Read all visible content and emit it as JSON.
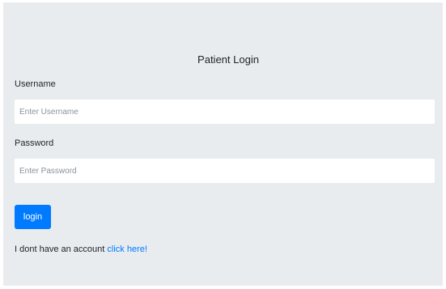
{
  "form": {
    "title": "Patient Login",
    "username_label": "Username",
    "username_placeholder": "Enter Username",
    "password_label": "Password",
    "password_placeholder": "Enter Password",
    "login_button": "login",
    "signup_prompt": "I dont have an account",
    "signup_link": "click here!"
  },
  "colors": {
    "background": "#e9ecef",
    "accent": "#007bff",
    "input_background": "#ffffff"
  }
}
